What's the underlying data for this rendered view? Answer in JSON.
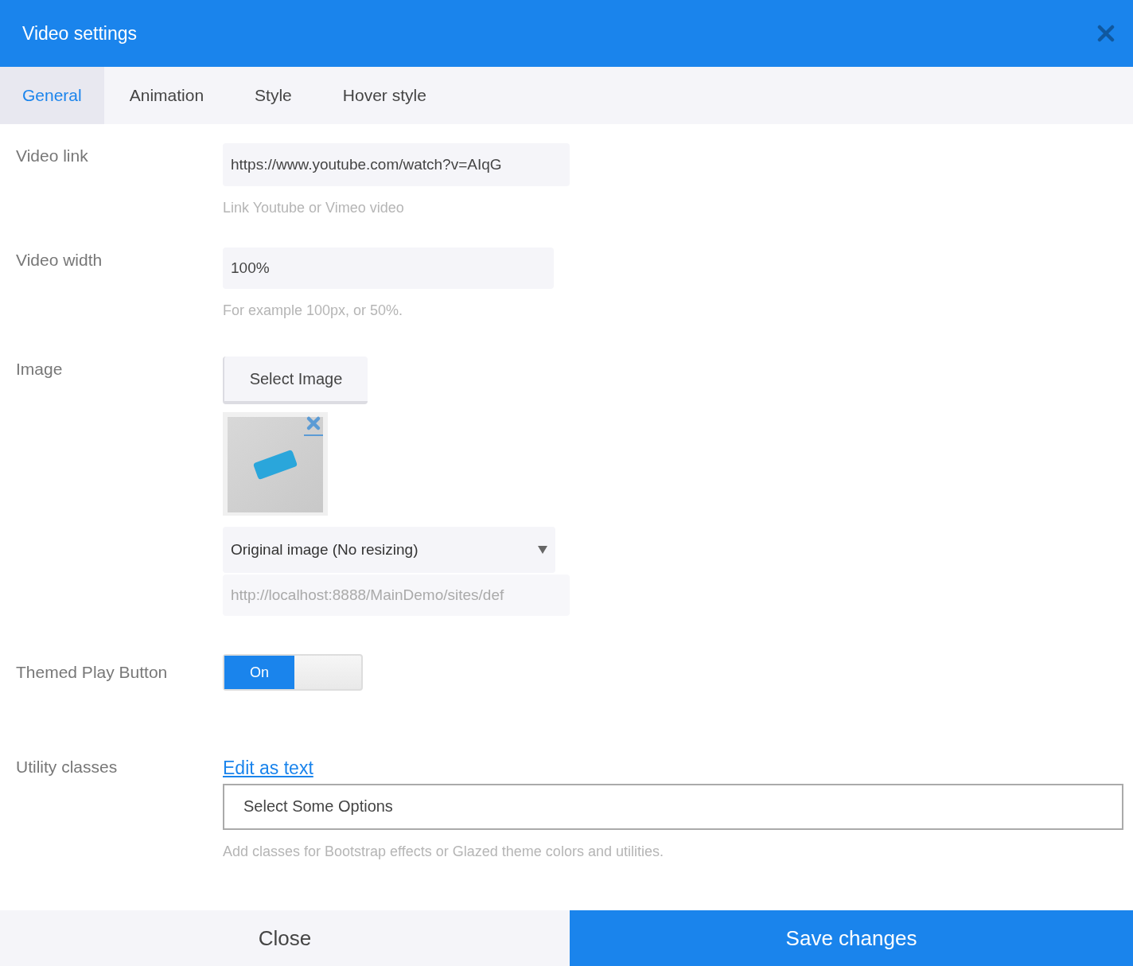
{
  "window": {
    "title": "Video settings"
  },
  "tabs": [
    {
      "label": "General",
      "selected": true
    },
    {
      "label": "Animation",
      "selected": false
    },
    {
      "label": "Style",
      "selected": false
    },
    {
      "label": "Hover style",
      "selected": false
    }
  ],
  "video_link": {
    "label": "Video link",
    "value": "https://www.youtube.com/watch?v=AIqG",
    "hint": "Link Youtube or Vimeo video"
  },
  "video_width": {
    "label": "Video width",
    "value": "100%",
    "hint": "For example 100px, or 50%."
  },
  "image": {
    "label": "Image",
    "button": "Select Image",
    "size_select": "Original image (No resizing)",
    "url": {
      "placeholder": "http://localhost:8888/MainDemo/sites/def"
    }
  },
  "themed_play_button": {
    "label": "Themed Play Button",
    "on": true,
    "on_label": "On"
  },
  "utility_classes": {
    "label": "Utility classes",
    "link": "Edit as text",
    "placeholder": "Select Some Options",
    "hint": "Add classes for Bootstrap effects or Glazed theme colors and utilities."
  },
  "buttons": [
    {
      "label": "Close",
      "kind": "secondary"
    },
    {
      "label": "Save changes",
      "kind": "primary"
    }
  ]
}
